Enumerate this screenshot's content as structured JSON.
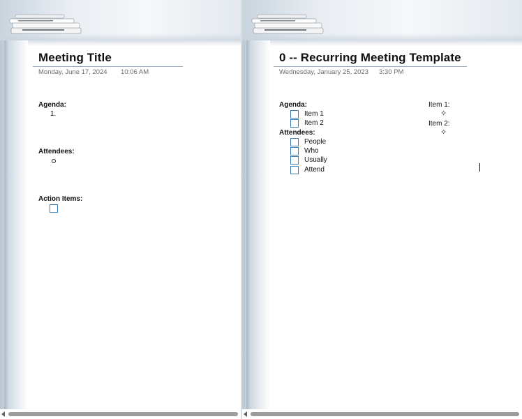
{
  "left_page": {
    "title": "Meeting Title",
    "date": "Monday, June 17, 2024",
    "time": "10:06 AM",
    "agenda_label": "Agenda:",
    "agenda_items": [
      "1."
    ],
    "attendees_label": "Attendees:",
    "action_items_label": "Action Items:"
  },
  "right_page": {
    "title": "0 -- Recurring Meeting Template",
    "date": "Wednesday, January 25, 2023",
    "time": "3:30 PM",
    "agenda_label": "Agenda:",
    "agenda_items": [
      "Item 1",
      "Item 2"
    ],
    "attendees_label": "Attendees:",
    "attendees": [
      "People",
      "Who",
      "Usually",
      "Attend"
    ],
    "side_labels": [
      "Item 1:",
      "Item 2:"
    ]
  },
  "icons": {
    "papers": "stacked-papers-icon",
    "checkbox": "checkbox-icon",
    "star": "four-point-star-icon"
  },
  "colors": {
    "checkbox_border": "#3a7fb8",
    "header_band": "#e9eef3",
    "side_strip": "#c6d2dd"
  }
}
